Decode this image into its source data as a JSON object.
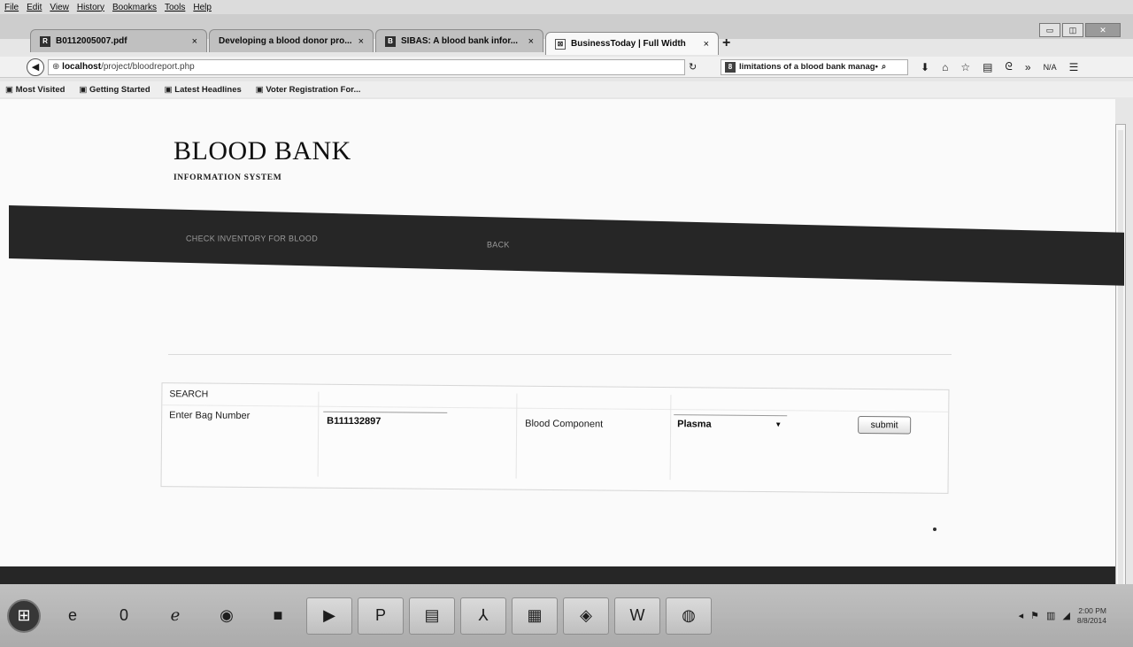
{
  "menu": [
    "File",
    "Edit",
    "View",
    "History",
    "Bookmarks",
    "Tools",
    "Help"
  ],
  "tabs": [
    {
      "title": "B0112005007.pdf",
      "icon": "R"
    },
    {
      "title": "Developing a blood donor pro...",
      "icon": ""
    },
    {
      "title": "SIBAS: A blood bank infor...",
      "icon": "B"
    },
    {
      "title": "BusinessToday | Full Width",
      "icon": "⊠"
    }
  ],
  "address": {
    "host": "localhost",
    "path": "/project/bloodreport.php"
  },
  "search": {
    "engine_icon": "8",
    "query": "limitations of a blood bank manag•"
  },
  "toolbar": {
    "na_label": "N/A"
  },
  "bookmarks": [
    "Most Visited",
    "Getting Started",
    "Latest Headlines",
    "Voter Registration For..."
  ],
  "site": {
    "title": "BLOOD BANK",
    "subtitle": "INFORMATION SYSTEM"
  },
  "nav": {
    "check_inventory": "CHECK INVENTORY FOR BLOOD",
    "back": "BACK"
  },
  "form": {
    "heading": "SEARCH",
    "bag_label": "Enter Bag Number",
    "bag_value": "B111132897",
    "component_label": "Blood Component",
    "component_value": "Plasma",
    "submit": "submit"
  },
  "tray": {
    "time": "2:00 PM",
    "date": "8/8/2014"
  },
  "taskbar_items": [
    {
      "name": "ie-icon",
      "glyph": "e"
    },
    {
      "name": "opera-icon",
      "glyph": "0"
    },
    {
      "name": "ie-old-icon",
      "glyph": "ℯ"
    },
    {
      "name": "chrome-icon",
      "glyph": "◉"
    },
    {
      "name": "folder-icon",
      "glyph": "■"
    },
    {
      "name": "media-icon",
      "glyph": "▶"
    },
    {
      "name": "publisher-icon",
      "glyph": "P"
    },
    {
      "name": "scanner-icon",
      "glyph": "▤"
    },
    {
      "name": "acrobat-icon",
      "glyph": "⅄"
    },
    {
      "name": "project-icon",
      "glyph": "▦"
    },
    {
      "name": "app-icon",
      "glyph": "◈"
    },
    {
      "name": "word-icon",
      "glyph": "W"
    },
    {
      "name": "firefox-icon",
      "glyph": "◍"
    }
  ]
}
